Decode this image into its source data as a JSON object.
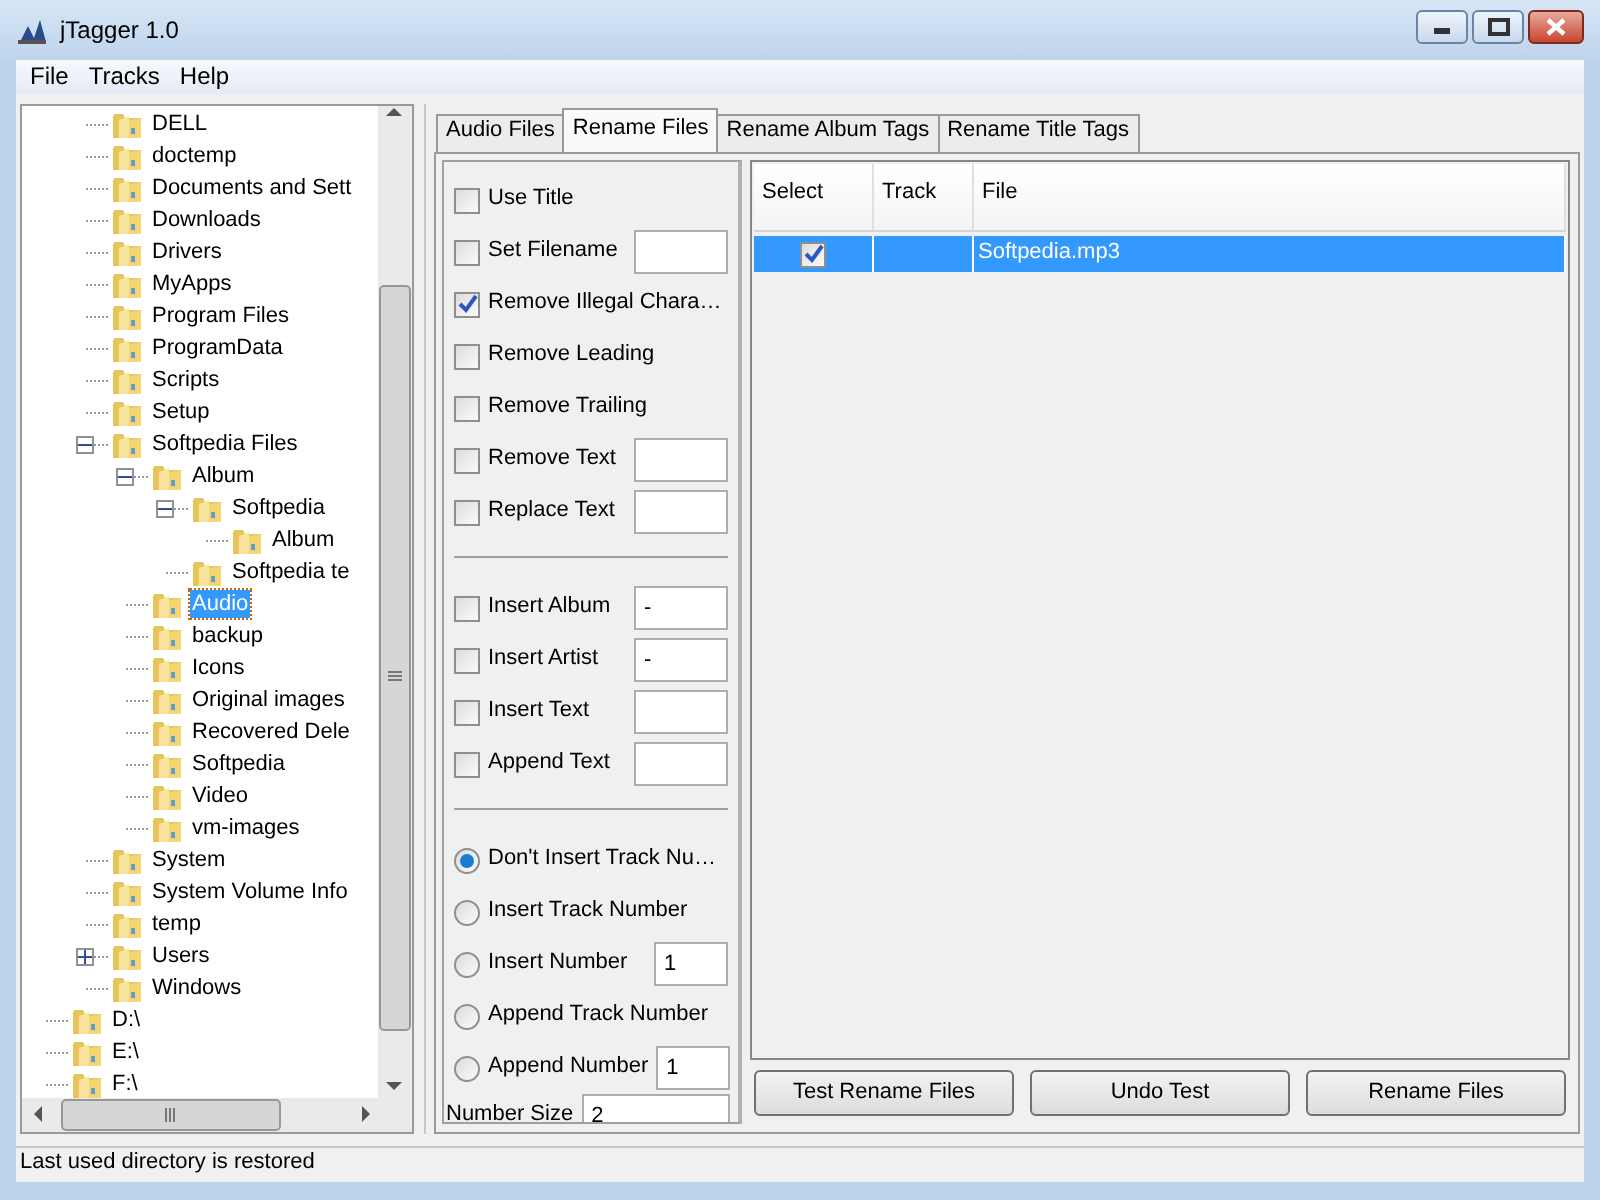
{
  "window": {
    "title": "jTagger 1.0"
  },
  "menu": [
    "File",
    "Tracks",
    "Help"
  ],
  "tree": {
    "items": [
      {
        "children": [
          {
            "label": "DELL",
            "selected": false
          },
          {
            "label": "doctemp",
            "selected": false
          },
          {
            "label": "Documents and Sett",
            "selected": false
          },
          {
            "label": "Downloads",
            "selected": false
          },
          {
            "label": "Drivers",
            "selected": false
          },
          {
            "label": "MyApps",
            "selected": false
          },
          {
            "label": "Program Files",
            "selected": false
          },
          {
            "label": "ProgramData",
            "selected": false
          },
          {
            "label": "Scripts",
            "selected": false
          },
          {
            "label": "Setup",
            "selected": false
          },
          {
            "label": "Softpedia Files",
            "selected": false,
            "expanded": true,
            "children": [
              {
                "label": "Album",
                "selected": false,
                "expanded": true,
                "children": [
                  {
                    "label": "Softpedia",
                    "selected": false,
                    "expanded": true,
                    "children": [
                      {
                        "label": "Album",
                        "selected": false
                      }
                    ]
                  },
                  {
                    "label": "Softpedia te",
                    "selected": false
                  }
                ]
              },
              {
                "label": "Audio",
                "selected": true
              },
              {
                "label": "backup",
                "selected": false
              },
              {
                "label": "Icons",
                "selected": false
              },
              {
                "label": "Original images",
                "selected": false
              },
              {
                "label": "Recovered Dele",
                "selected": false
              },
              {
                "label": "Softpedia",
                "selected": false
              },
              {
                "label": "Video",
                "selected": false
              },
              {
                "label": "vm-images",
                "selected": false
              }
            ]
          },
          {
            "label": "System",
            "selected": false
          },
          {
            "label": "System Volume Info",
            "selected": false
          },
          {
            "label": "temp",
            "selected": false
          },
          {
            "label": "Users",
            "selected": false,
            "expanded": false
          },
          {
            "label": "Windows",
            "selected": false
          }
        ]
      },
      {
        "label": "D:\\",
        "selected": false
      },
      {
        "label": "E:\\",
        "selected": false
      },
      {
        "label": "F:\\",
        "selected": false
      }
    ]
  },
  "tabs": [
    {
      "label": "Audio Files",
      "selected": false
    },
    {
      "label": "Rename Files",
      "selected": true
    },
    {
      "label": "Rename Album Tags",
      "selected": false
    },
    {
      "label": "Rename Title Tags",
      "selected": false
    }
  ],
  "option_groups": [
    [
      {
        "kind": "checkbox",
        "label": "Use Title",
        "checked": false
      },
      {
        "kind": "checkbox_field",
        "label": "Set Filename",
        "checked": false
      },
      {
        "kind": "checkbox",
        "label": "Remove Illegal Chara…",
        "checked": true
      },
      {
        "kind": "checkbox",
        "label": "Remove Leading",
        "checked": false
      },
      {
        "kind": "checkbox",
        "label": "Remove Trailing",
        "checked": false
      },
      {
        "kind": "checkbox_field",
        "label": "Remove Text",
        "checked": false
      },
      {
        "kind": "checkbox_field",
        "label": "Replace Text",
        "checked": false
      }
    ],
    [
      {
        "kind": "checkbox_field",
        "label": "Insert Album",
        "checked": false,
        "value": "-"
      },
      {
        "kind": "checkbox_field",
        "label": "Insert Artist",
        "checked": false,
        "value": "-"
      },
      {
        "kind": "checkbox_field",
        "label": "Insert Text",
        "checked": false
      },
      {
        "kind": "checkbox_field",
        "label": "Append Text",
        "checked": false
      }
    ],
    [
      {
        "kind": "radio",
        "label": "Don't Insert Track Nu…",
        "selected": true
      },
      {
        "kind": "radio",
        "label": "Insert Track Number",
        "selected": false
      },
      {
        "kind": "radio_field",
        "label": "Insert Number",
        "selected": false,
        "value": "1"
      },
      {
        "kind": "radio",
        "label": "Append Track Number",
        "selected": false
      },
      {
        "kind": "radio_field",
        "label": "Append Number",
        "selected": false,
        "value": "1"
      },
      {
        "kind": "field",
        "label": "Number Size",
        "value": "2"
      }
    ]
  ],
  "table": {
    "columns": [
      "Select",
      "Track",
      "File"
    ],
    "rows": [
      {
        "selected": true,
        "checked": true,
        "file": "Softpedia.mp3"
      }
    ]
  },
  "buttons": [
    "Test Rename Files",
    "Undo Test",
    "Rename Files"
  ],
  "status_bar": "Last used directory is restored"
}
